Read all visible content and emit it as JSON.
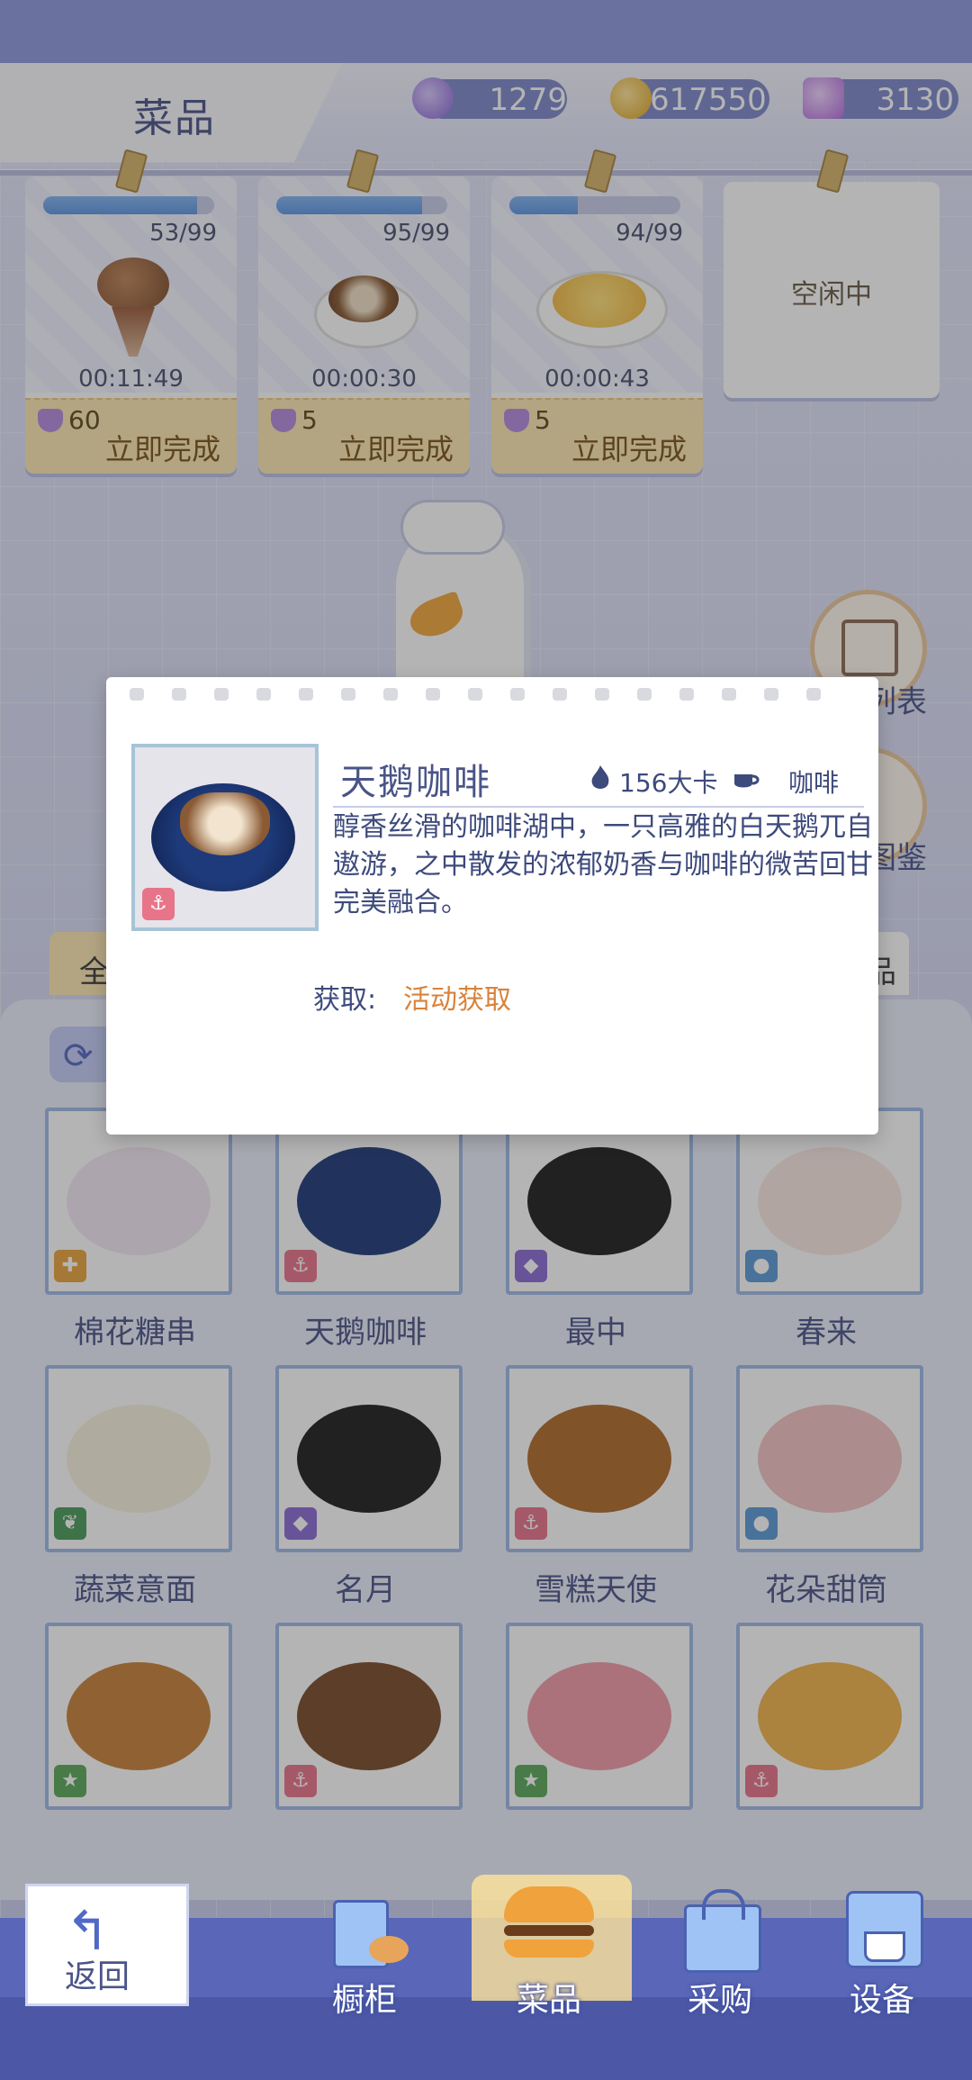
{
  "header": {
    "title": "菜品",
    "currencies": [
      {
        "icon": "amethyst-coin-icon",
        "value": "1279"
      },
      {
        "icon": "gold-coin-icon",
        "value": "617550"
      },
      {
        "icon": "crystal-plus-icon",
        "value": "3130"
      }
    ]
  },
  "cooking": [
    {
      "count": "53/99",
      "timer": "00:11:49",
      "cost": "60",
      "finish_label": "立即完成",
      "progress": 0.9
    },
    {
      "count": "95/99",
      "timer": "00:00:30",
      "cost": "5",
      "finish_label": "立即完成",
      "progress": 0.85
    },
    {
      "count": "94/99",
      "timer": "00:00:43",
      "cost": "5",
      "finish_label": "立即完成",
      "progress": 0.4
    }
  ],
  "idle_slot": {
    "label": "空闲中"
  },
  "side_buttons": {
    "list_label": "列表",
    "guide_label": "图鉴"
  },
  "category": {
    "active_tab": "全",
    "right_tab": "品"
  },
  "popup": {
    "name": "天鹅咖啡",
    "calories": "156大卡",
    "type": "咖啡",
    "description": "醇香丝滑的咖啡湖中，一只高雅的白天鹅兀自遨游，之中散发的浓郁奶香与咖啡的微苦回甘完美融合。",
    "source_label": "获取:",
    "source_value": "活动获取"
  },
  "dishes": [
    {
      "name": "棉花糖串",
      "badge": "puzzle-badge-icon",
      "badge_color": "#e8a33c"
    },
    {
      "name": "天鹅咖啡",
      "badge": "anchor-badge-icon",
      "badge_color": "#e8748a"
    },
    {
      "name": "最中",
      "badge": "diamond-badge-icon",
      "badge_color": "#8a6bd4"
    },
    {
      "name": "春来",
      "badge": "bulb-badge-icon",
      "badge_color": "#5a9ad8"
    },
    {
      "name": "蔬菜意面",
      "badge": "leaf-badge-icon",
      "badge_color": "#4a9a5a"
    },
    {
      "name": "名月",
      "badge": "diamond-badge-icon",
      "badge_color": "#8a6bd4"
    },
    {
      "name": "雪糕天使",
      "badge": "anchor-badge-icon",
      "badge_color": "#e8748a"
    },
    {
      "name": "花朵甜筒",
      "badge": "bulb-badge-icon",
      "badge_color": "#5a9ad8"
    },
    {
      "name": "",
      "badge": "star-badge-icon",
      "badge_color": "#5aa85a"
    },
    {
      "name": "",
      "badge": "anchor-badge-icon",
      "badge_color": "#e8748a"
    },
    {
      "name": "",
      "badge": "star-badge-icon",
      "badge_color": "#5aa85a"
    },
    {
      "name": "",
      "badge": "anchor-badge-icon",
      "badge_color": "#e8748a"
    }
  ],
  "nav": {
    "back": "返回",
    "items": [
      {
        "label": "橱柜",
        "icon": "cabinet-icon"
      },
      {
        "label": "菜品",
        "icon": "burger-icon"
      },
      {
        "label": "采购",
        "icon": "shopping-bag-icon"
      },
      {
        "label": "设备",
        "icon": "coffee-machine-icon"
      }
    ]
  }
}
